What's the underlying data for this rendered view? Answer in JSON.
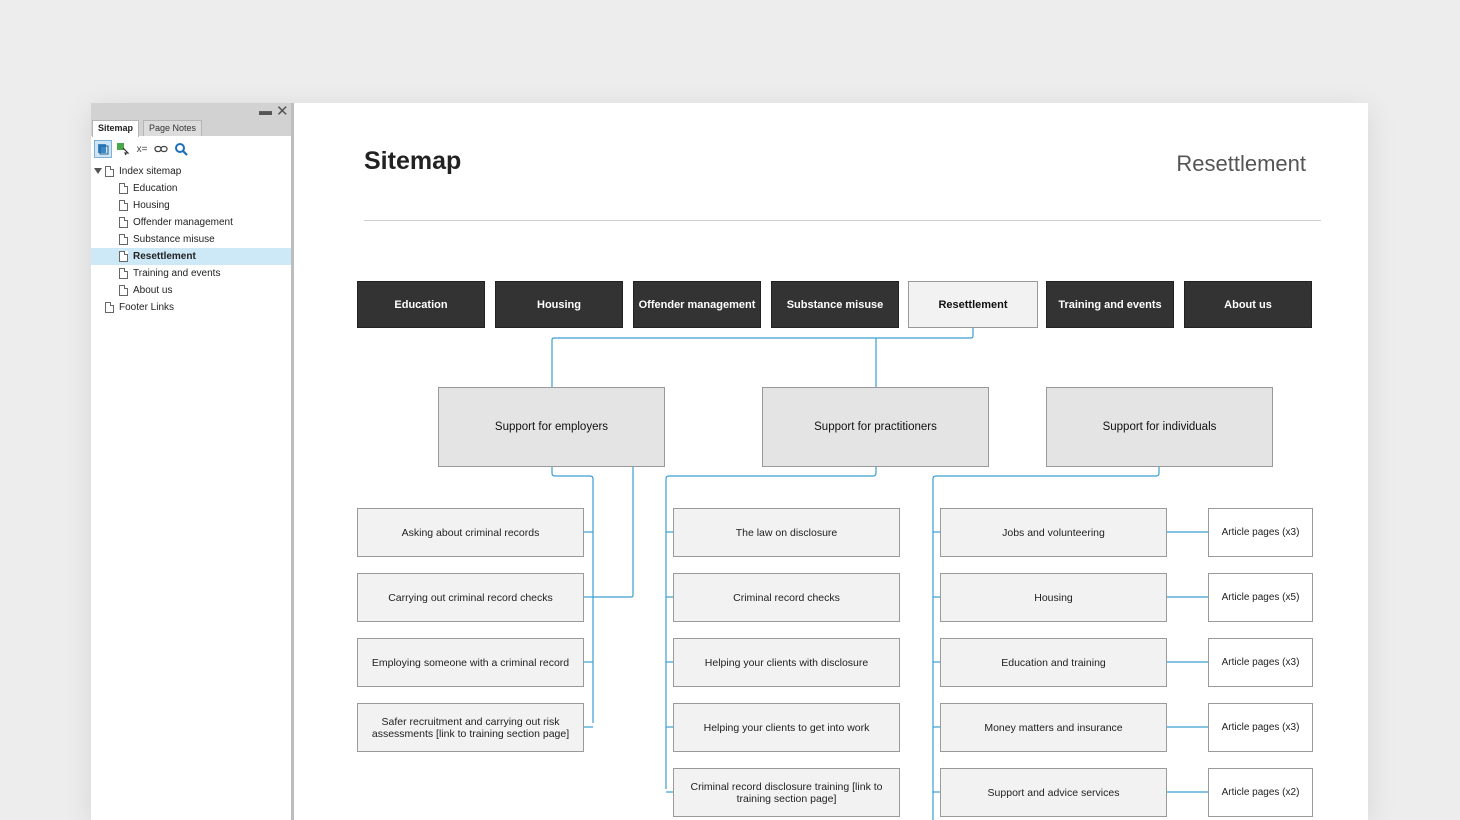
{
  "panel": {
    "tabs": [
      {
        "label": "Sitemap",
        "active": true
      },
      {
        "label": "Page Notes",
        "active": false
      }
    ],
    "window_controls": {
      "minimize": "▬",
      "close": "✕"
    },
    "toolbar": [
      {
        "icon": "map-view-icon",
        "active": true
      },
      {
        "icon": "add-page-icon",
        "active": false
      },
      {
        "icon": "variables-icon",
        "glyph": "x=",
        "active": false
      },
      {
        "icon": "link-icon",
        "glyph": "⊖",
        "active": false
      },
      {
        "icon": "search-icon",
        "active": false
      }
    ],
    "tree": [
      {
        "label": "Index sitemap",
        "level": 0,
        "expanded": true,
        "selected": false
      },
      {
        "label": "Education",
        "level": 1,
        "selected": false
      },
      {
        "label": "Housing",
        "level": 1,
        "selected": false
      },
      {
        "label": "Offender management",
        "level": 1,
        "selected": false
      },
      {
        "label": "Substance misuse",
        "level": 1,
        "selected": false
      },
      {
        "label": "Resettlement",
        "level": 1,
        "selected": true
      },
      {
        "label": "Training and events",
        "level": 1,
        "selected": false
      },
      {
        "label": "About us",
        "level": 1,
        "selected": false
      },
      {
        "label": "Footer Links",
        "level": 0,
        "selected": false
      }
    ]
  },
  "main": {
    "title": "Sitemap",
    "section": "Resettlement",
    "nav": [
      {
        "label": "Education",
        "current": false
      },
      {
        "label": "Housing",
        "current": false
      },
      {
        "label": "Offender management",
        "current": false
      },
      {
        "label": "Substance misuse",
        "current": false
      },
      {
        "label": "Resettlement",
        "current": true
      },
      {
        "label": "Training and events",
        "current": false
      },
      {
        "label": "About us",
        "current": false
      }
    ],
    "sections": [
      {
        "label": "Support for employers"
      },
      {
        "label": "Support for practitioners"
      },
      {
        "label": "Support for individuals"
      }
    ],
    "employer_pages": [
      "Asking about criminal records",
      "Carrying out criminal record checks",
      "Employing someone with a criminal record",
      "Safer recruitment and carrying out risk assessments [link to training section page]"
    ],
    "practitioner_pages": [
      "The law on disclosure",
      "Criminal record checks",
      "Helping your clients with disclosure",
      "Helping your clients to get into work",
      "Criminal record disclosure training [link to training section page]"
    ],
    "individual_pages": [
      {
        "label": "Jobs and volunteering",
        "articles": "Article pages (x3)"
      },
      {
        "label": "Housing",
        "articles": "Article pages (x5)"
      },
      {
        "label": "Education and training",
        "articles": "Article pages (x3)"
      },
      {
        "label": "Money matters and insurance",
        "articles": "Article pages (x3)"
      },
      {
        "label": "Support and advice services",
        "articles": "Article pages (x2)"
      }
    ]
  },
  "colors": {
    "connector": "#3a9fd0",
    "nav_dark": "#333333",
    "selection": "#cde8f6"
  }
}
